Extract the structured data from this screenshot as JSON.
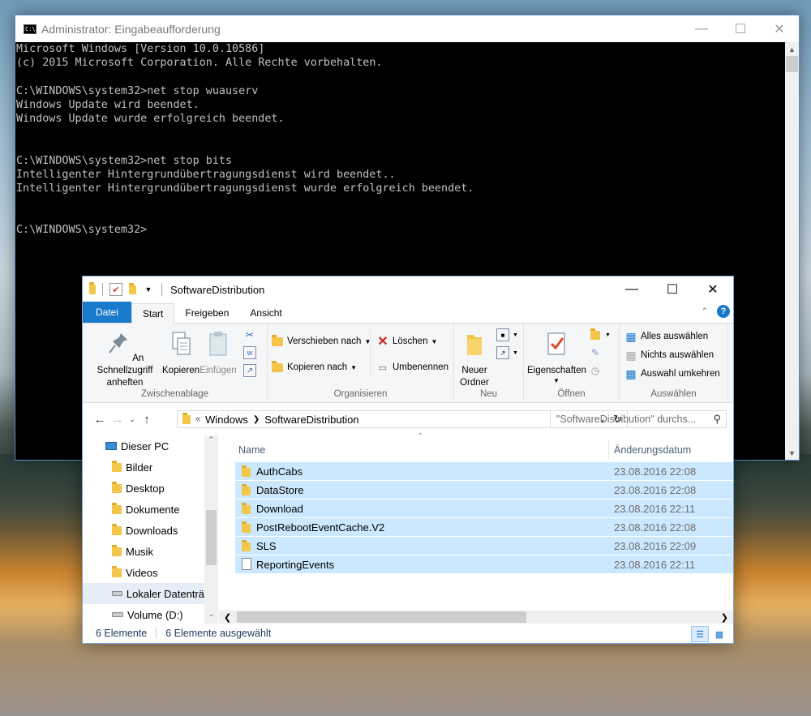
{
  "cmd": {
    "title": "Administrator: Eingabeaufforderung",
    "lines": [
      "Microsoft Windows [Version 10.0.10586]",
      "(c) 2015 Microsoft Corporation. Alle Rechte vorbehalten.",
      "",
      "C:\\WINDOWS\\system32>net stop wuauserv",
      "Windows Update wird beendet.",
      "Windows Update wurde erfolgreich beendet.",
      "",
      "",
      "C:\\WINDOWS\\system32>net stop bits",
      "Intelligenter Hintergrundübertragungsdienst wird beendet..",
      "Intelligenter Hintergrundübertragungsdienst wurde erfolgreich beendet.",
      "",
      "",
      "C:\\WINDOWS\\system32>"
    ],
    "minimize": "—",
    "maximize": "☐",
    "close": "✕"
  },
  "explorer": {
    "title": "SoftwareDistribution",
    "minimize": "—",
    "maximize": "☐",
    "close": "✕",
    "tabs": {
      "file": "Datei",
      "start": "Start",
      "share": "Freigeben",
      "view": "Ansicht"
    },
    "help": "?",
    "ribbon": {
      "clipboard": {
        "label": "Zwischenablage",
        "pin": "An Schnellzugriff anheften",
        "copy": "Kopieren",
        "paste": "Einfügen"
      },
      "organize": {
        "label": "Organisieren",
        "move": "Verschieben nach",
        "copy_to": "Kopieren nach",
        "delete": "Löschen",
        "rename": "Umbenennen"
      },
      "new": {
        "label": "Neu",
        "new_folder": "Neuer Ordner"
      },
      "open": {
        "label": "Öffnen",
        "properties": "Eigenschaften"
      },
      "select": {
        "label": "Auswählen",
        "select_all": "Alles auswählen",
        "select_none": "Nichts auswählen",
        "invert": "Auswahl umkehren"
      }
    },
    "address": {
      "overflow": "«",
      "crumbs": [
        "Windows",
        "SoftwareDistribution"
      ],
      "search_placeholder": "\"SoftwareDistribution\" durchs..."
    },
    "nav_pane": [
      {
        "label": "Dieser PC",
        "icon": "computer-icon"
      },
      {
        "label": "Bilder",
        "icon": "pictures-folder-icon"
      },
      {
        "label": "Desktop",
        "icon": "desktop-folder-icon"
      },
      {
        "label": "Dokumente",
        "icon": "documents-folder-icon"
      },
      {
        "label": "Downloads",
        "icon": "downloads-folder-icon"
      },
      {
        "label": "Musik",
        "icon": "music-folder-icon"
      },
      {
        "label": "Videos",
        "icon": "videos-folder-icon"
      },
      {
        "label": "Lokaler Datenträ",
        "icon": "drive-icon"
      },
      {
        "label": "Volume (D:)",
        "icon": "drive-icon"
      }
    ],
    "columns": {
      "name": "Name",
      "date": "Änderungsdatum"
    },
    "files": [
      {
        "name": "AuthCabs",
        "date": "23.08.2016 22:08",
        "type": "folder"
      },
      {
        "name": "DataStore",
        "date": "23.08.2016 22:08",
        "type": "folder"
      },
      {
        "name": "Download",
        "date": "23.08.2016 22:11",
        "type": "folder"
      },
      {
        "name": "PostRebootEventCache.V2",
        "date": "23.08.2016 22:08",
        "type": "folder"
      },
      {
        "name": "SLS",
        "date": "23.08.2016 22:09",
        "type": "folder"
      },
      {
        "name": "ReportingEvents",
        "date": "23.08.2016 22:11",
        "type": "file"
      }
    ],
    "status": {
      "count": "6 Elemente",
      "selected": "6 Elemente ausgewählt"
    }
  }
}
